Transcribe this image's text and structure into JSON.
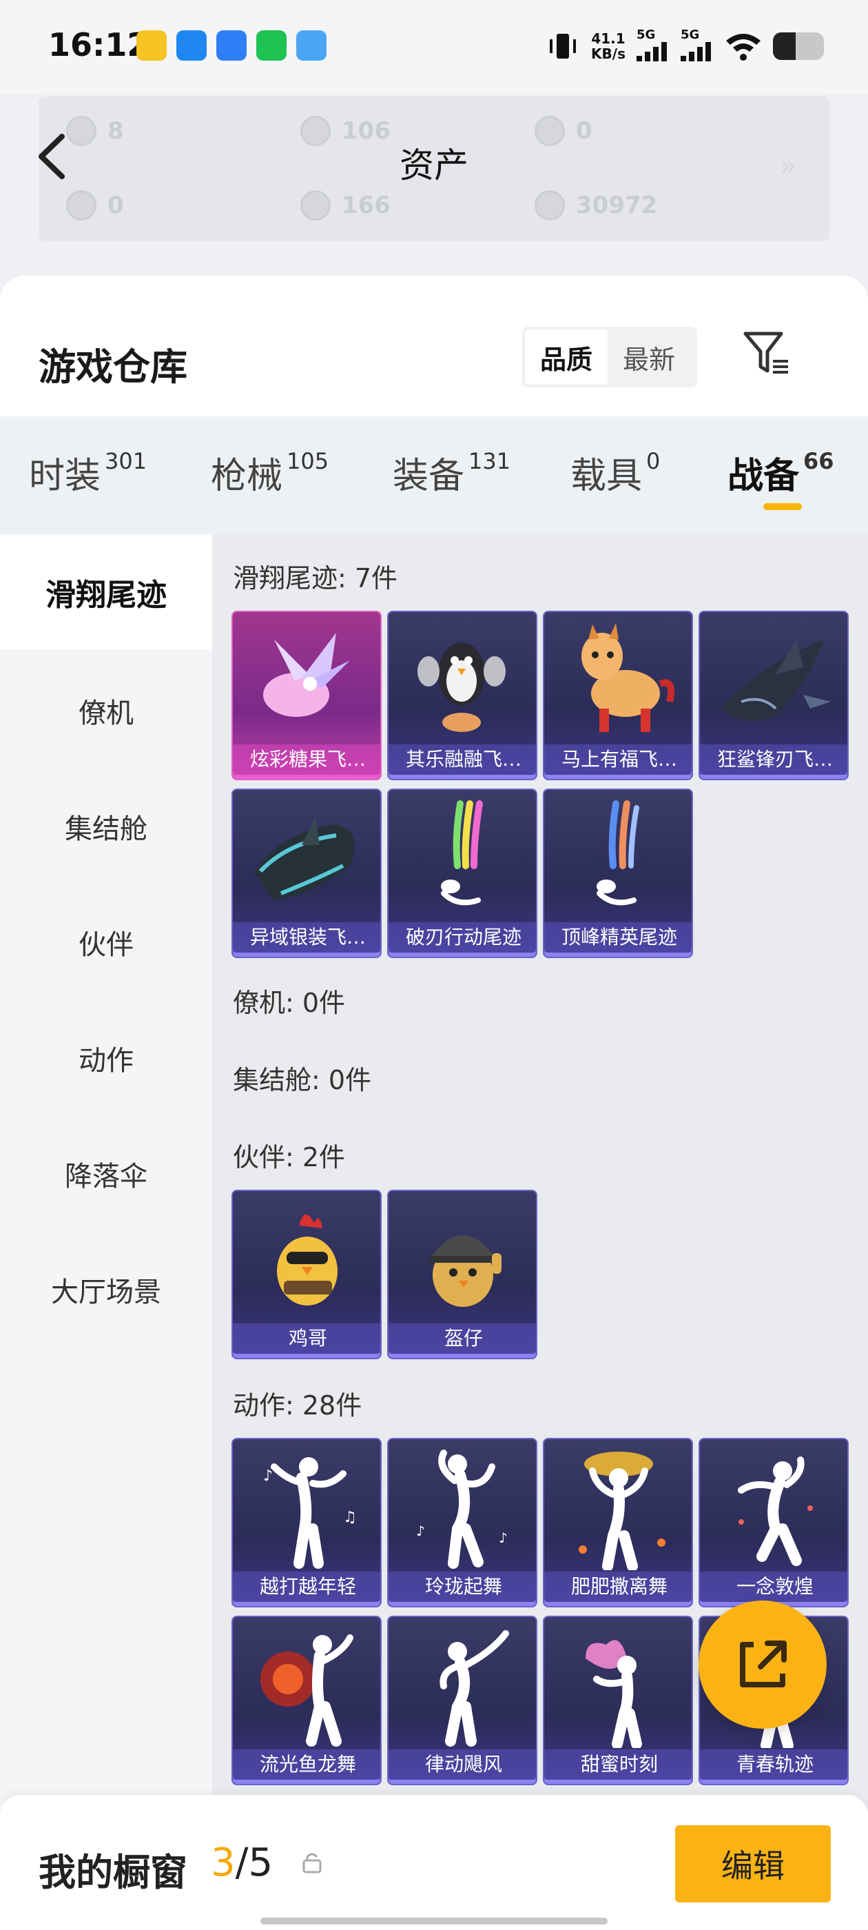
{
  "status_bar": {
    "time": "16:12",
    "net_speed_value": "41.1",
    "net_speed_unit": "KB/s",
    "signal_1": "5G",
    "signal_2": "5G",
    "battery_level": 0.45
  },
  "asset_header": {
    "title": "资产",
    "values": [
      "8",
      "106",
      "0",
      "0",
      "166",
      "30972"
    ]
  },
  "warehouse": {
    "title": "游戏仓库",
    "sort_options": [
      "品质",
      "最新"
    ],
    "sort_selected": "品质"
  },
  "category_tabs": [
    {
      "label": "时装",
      "count": "301"
    },
    {
      "label": "枪械",
      "count": "105"
    },
    {
      "label": "装备",
      "count": "131"
    },
    {
      "label": "载具",
      "count": "0"
    },
    {
      "label": "战备",
      "count": "66"
    }
  ],
  "active_tab": "战备",
  "sidebar": {
    "items": [
      "滑翔尾迹",
      "僚机",
      "集结舱",
      "伙伴",
      "动作",
      "降落伞",
      "大厅场景"
    ],
    "active": "滑翔尾迹"
  },
  "sections": [
    {
      "title": "滑翔尾迹: 7件",
      "items": [
        "炫彩糖果飞…",
        "其乐融融飞…",
        "马上有福飞…",
        "狂鲨锋刃飞…",
        "异域银装飞…",
        "破刃行动尾迹",
        "顶峰精英尾迹"
      ]
    },
    {
      "title": "僚机: 0件",
      "items": []
    },
    {
      "title": "集结舱: 0件",
      "items": []
    },
    {
      "title": "伙伴: 2件",
      "items": [
        "鸡哥",
        "盔仔"
      ]
    },
    {
      "title": "动作: 28件",
      "items": [
        "越打越年轻",
        "玲珑起舞",
        "肥肥撒离舞",
        "一念敦煌",
        "流光鱼龙舞",
        "律动飓风",
        "甜蜜时刻",
        "青春轨迹"
      ]
    }
  ],
  "showcase": {
    "title": "我的橱窗",
    "current": "3",
    "total": "5",
    "edit_label": "编辑"
  }
}
